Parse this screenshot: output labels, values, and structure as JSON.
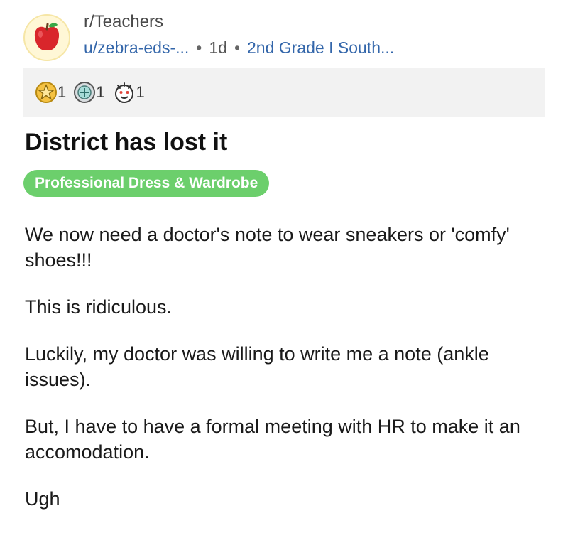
{
  "post": {
    "subreddit": "r/Teachers",
    "author": "u/zebra-eds-...",
    "age": "1d",
    "author_flair": "2nd Grade I South...",
    "separator": "•",
    "awards": [
      {
        "icon": "gold-star-award-icon",
        "count": "1"
      },
      {
        "icon": "silver-medal-award-icon",
        "count": "1"
      },
      {
        "icon": "wholesome-face-award-icon",
        "count": "1"
      }
    ],
    "title": "District has lost it",
    "flair": "Professional Dress & Wardrobe",
    "body": [
      "We now need a doctor's note to wear sneakers or 'comfy' shoes!!!",
      "This is ridiculous.",
      "Luckily, my doctor was willing to write me a note (ankle issues).",
      "But, I have to have a formal meeting with HR to make it an accomodation.",
      "Ugh"
    ]
  },
  "colors": {
    "flair_bg": "#6ccf6c",
    "link": "#3366aa",
    "awards_bar": "#f2f2f2",
    "avatar_bg": "#fff7d6"
  }
}
